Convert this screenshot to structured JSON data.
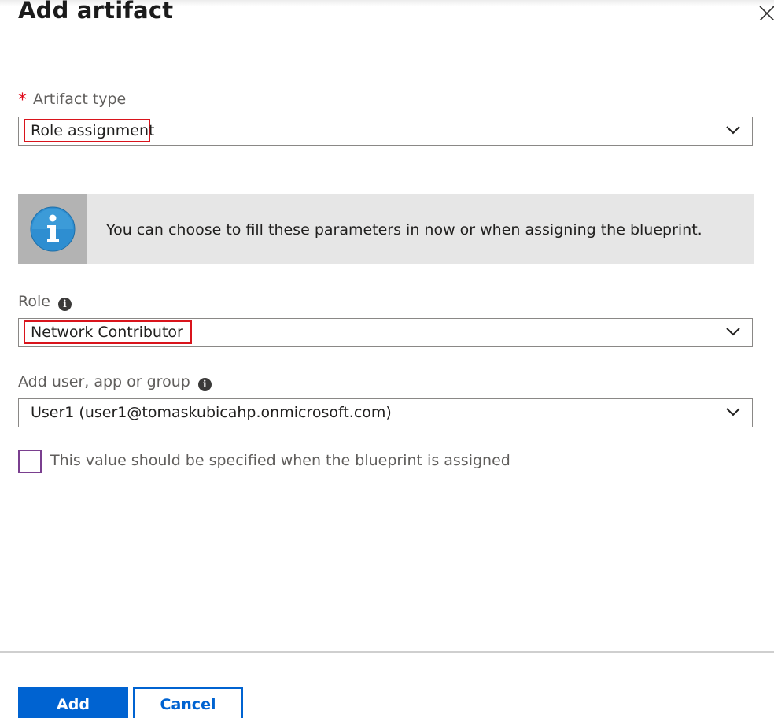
{
  "dialog": {
    "title": "Add artifact"
  },
  "artifact_type": {
    "label": "Artifact type",
    "required_mark": "*",
    "value": "Role assignment"
  },
  "info_banner": {
    "message": "You can choose to fill these parameters in now or when assigning the blueprint."
  },
  "role": {
    "label": "Role",
    "value": "Network Contributor"
  },
  "principal": {
    "label": "Add user, app or group",
    "value": "User1 (user1@tomaskubicahp.onmicrosoft.com)"
  },
  "specify_later": {
    "label": "This value should be specified when the blueprint is assigned",
    "checked": false
  },
  "footer": {
    "add_label": "Add",
    "cancel_label": "Cancel"
  },
  "icons": {
    "close": "close-icon",
    "chevron": "chevron-down-icon",
    "info": "info-icon"
  },
  "colors": {
    "primary": "#0063d1",
    "required": "#e00b1c",
    "highlight": "#d9141c",
    "checkbox_border": "#7a3f8f"
  }
}
